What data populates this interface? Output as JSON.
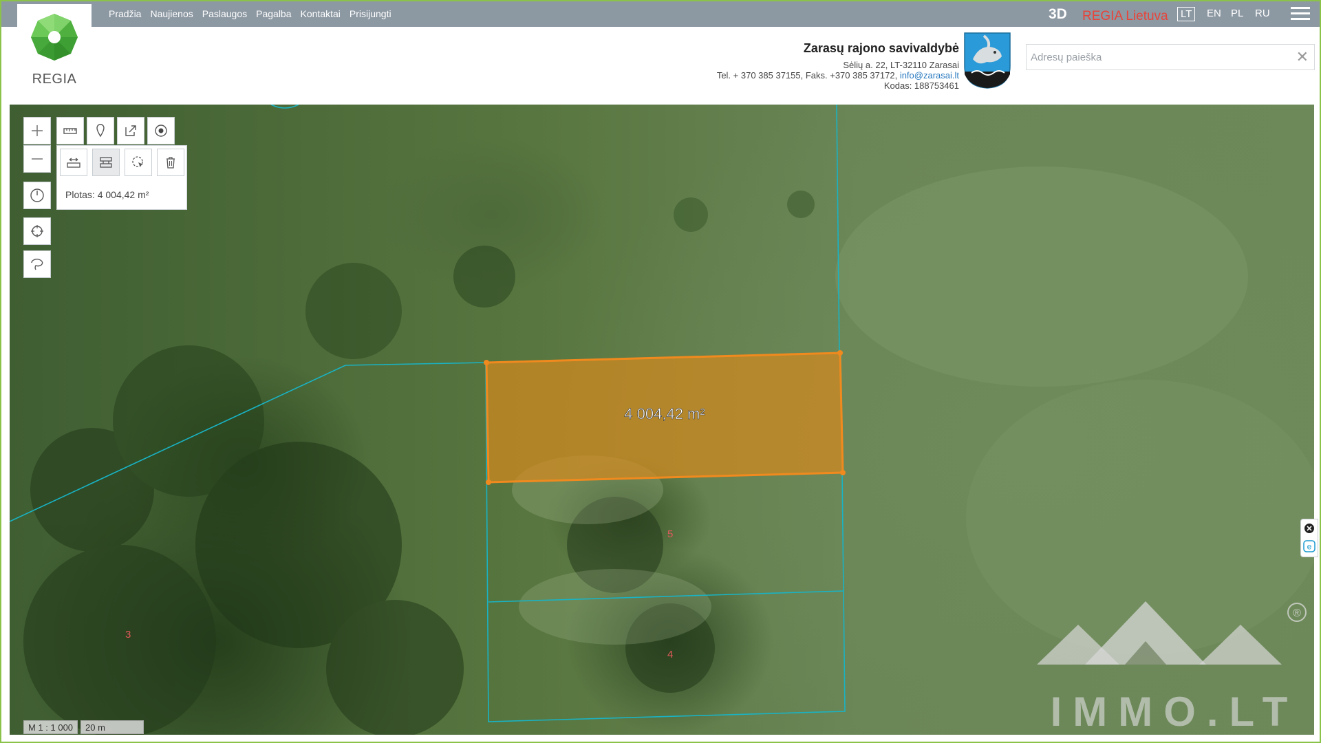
{
  "logo": {
    "text": "REGIA"
  },
  "nav": {
    "items": [
      "Pradžia",
      "Naujienos",
      "Paslaugos",
      "Pagalba",
      "Kontaktai",
      "Prisijungti"
    ],
    "btn_3d": "3D",
    "regia_title": "REGIA Lietuva",
    "languages": [
      "LT",
      "EN",
      "PL",
      "RU"
    ],
    "active_language": "LT"
  },
  "municipality": {
    "name": "Zarasų rajono savivaldybė",
    "address": "Sėlių a. 22, LT-32110 Zarasai",
    "phone_prefix": "Tel. + 370 385 37155, Faks. +370 385 37172, ",
    "email": "info@zarasai.lt",
    "code": "Kodas: 188753461"
  },
  "search": {
    "placeholder": "Adresų paieška",
    "value": "",
    "clear_icon": "✕"
  },
  "measure": {
    "readout": "Plotas: 4 004,42 m²",
    "polygon_label": "4 004,42 m²"
  },
  "parcel_labels": [
    "5",
    "4",
    "3"
  ],
  "scale": {
    "ratio": "M 1 : 1 000",
    "bar": "20 m"
  },
  "watermark": {
    "text": "IMMO.LT",
    "mark": "®"
  },
  "colors": {
    "topbar": "#8c98a2",
    "accent_red": "#e8443a",
    "polygon_stroke": "#f08a1e",
    "polygon_fill": "#d4891f",
    "parcel_lines": "#19b3c4",
    "frame_green": "#8bc34a"
  },
  "icons": {
    "zoom_in": "plus-icon",
    "zoom_out": "minus-icon",
    "ruler": "ruler-icon",
    "marker": "map-marker-icon",
    "share": "share-icon",
    "target": "target-icon",
    "history": "clock-icon",
    "locate": "crosshair-icon",
    "lasso": "lasso-icon",
    "measure_length": "measure-length-icon",
    "measure_area": "measure-area-icon",
    "select": "select-cursor-icon",
    "delete": "trash-icon"
  }
}
